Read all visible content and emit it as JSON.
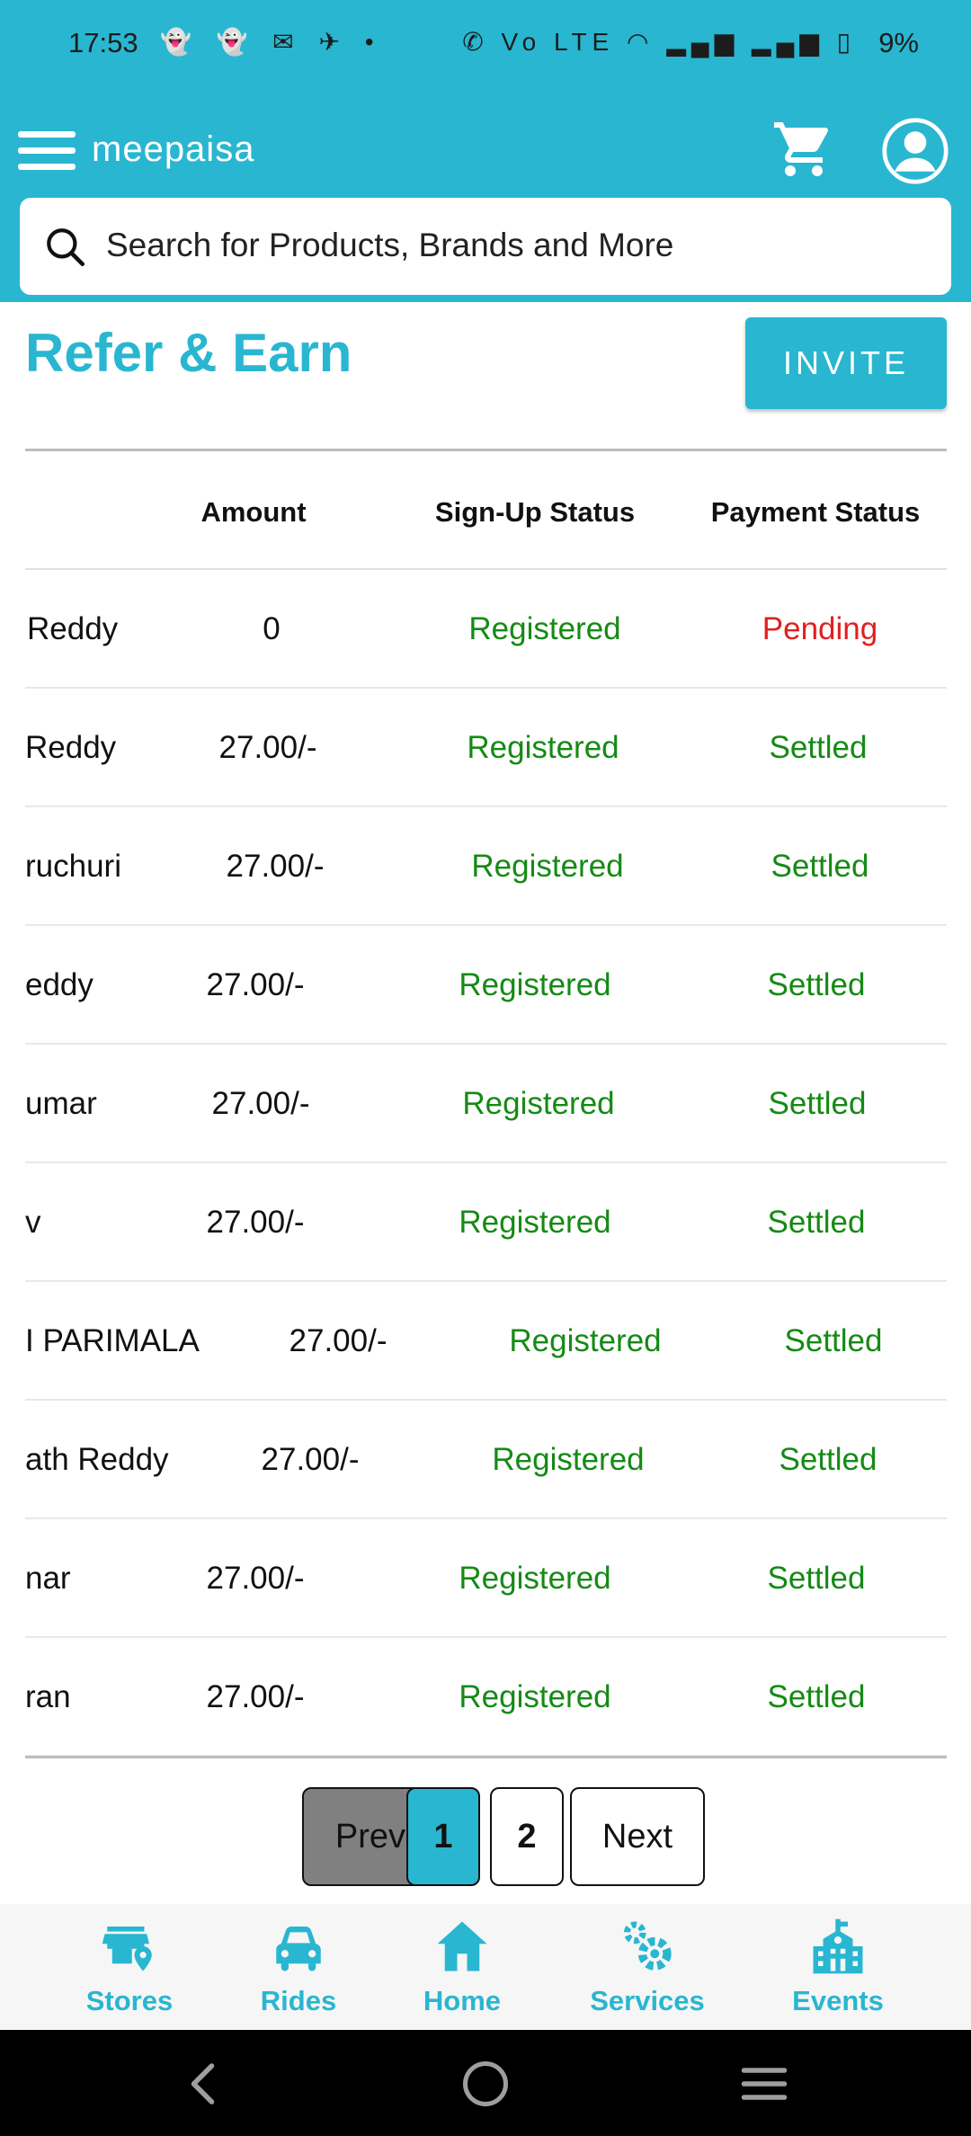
{
  "status_bar": {
    "time": "17:53",
    "left_icons": "👻 👻 ✉ ✈ •",
    "right_icons": "✆ Vo LTE ◠ ▂▄▆ ▂▄▆ ▯",
    "battery": "9%"
  },
  "app_bar": {
    "title": "meepaisa",
    "icons": [
      "menu-icon",
      "cart-icon",
      "account-icon"
    ]
  },
  "search": {
    "placeholder": "Search for Products, Brands and More",
    "icon": "search-icon"
  },
  "page": {
    "title": "Refer & Earn",
    "invite_label": "INVITE"
  },
  "table": {
    "headers": {
      "amount": "Amount",
      "signup": "Sign-Up Status",
      "payment": "Payment Status"
    },
    "rows": [
      {
        "name": "Reddy",
        "amount": "0",
        "signup": "Registered",
        "payment": "Pending"
      },
      {
        "name": "Reddy",
        "amount": "27.00/-",
        "signup": "Registered",
        "payment": "Settled"
      },
      {
        "name": "ruchuri",
        "amount": "27.00/-",
        "signup": "Registered",
        "payment": "Settled"
      },
      {
        "name": "eddy",
        "amount": "27.00/-",
        "signup": "Registered",
        "payment": "Settled"
      },
      {
        "name": "umar",
        "amount": "27.00/-",
        "signup": "Registered",
        "payment": "Settled"
      },
      {
        "name": "v",
        "amount": "27.00/-",
        "signup": "Registered",
        "payment": "Settled"
      },
      {
        "name": "I PARIMALA",
        "amount": "27.00/-",
        "signup": "Registered",
        "payment": "Settled"
      },
      {
        "name": "ath Reddy",
        "amount": "27.00/-",
        "signup": "Registered",
        "payment": "Settled"
      },
      {
        "name": "nar",
        "amount": "27.00/-",
        "signup": "Registered",
        "payment": "Settled"
      },
      {
        "name": "ran",
        "amount": "27.00/-",
        "signup": "Registered",
        "payment": "Settled"
      }
    ]
  },
  "pagination": {
    "prev": "Prev",
    "page1": "1",
    "page2": "2",
    "next": "Next"
  },
  "bottom_nav": [
    {
      "label": "Stores",
      "icon": "store-icon"
    },
    {
      "label": "Rides",
      "icon": "car-icon"
    },
    {
      "label": "Home",
      "icon": "home-icon"
    },
    {
      "label": "Services",
      "icon": "gears-icon"
    },
    {
      "label": "Events",
      "icon": "building-icon"
    }
  ],
  "colors": {
    "brand": "#29b6d1",
    "registered": "#158a15",
    "settled": "#158a15",
    "pending": "#e02020"
  }
}
